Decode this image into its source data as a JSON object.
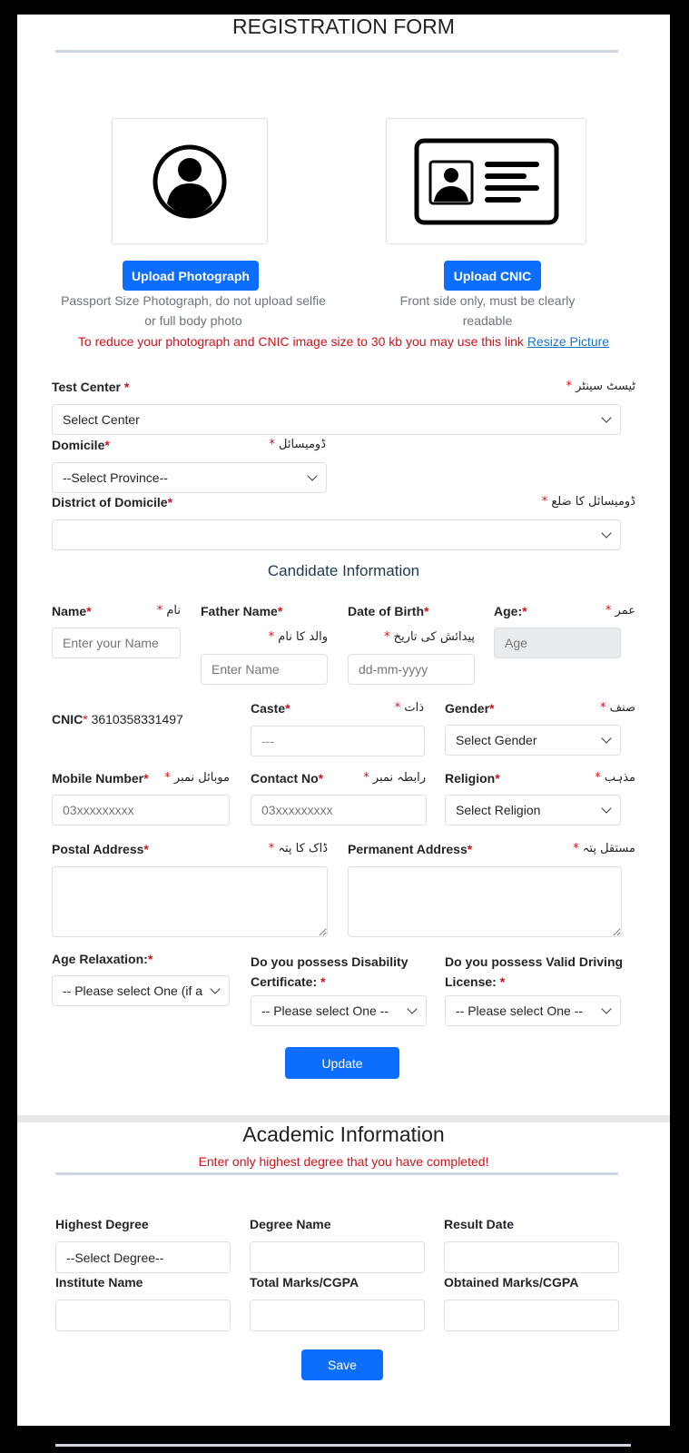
{
  "header": {
    "title": "REGISTRATION FORM"
  },
  "uploads": {
    "photo": {
      "icon": "user-avatar-icon",
      "button": "Upload Photograph",
      "hint_line1": "Passport Size Photograph, do not upload selfie",
      "hint_line2": "or full body photo"
    },
    "cnic": {
      "icon": "id-card-icon",
      "button": "Upload CNIC",
      "hint_line1": "Front side only, must be clearly",
      "hint_line2": "readable"
    },
    "notice": "To reduce your photograph and CNIC image size to 30 kb you may use this link",
    "notice_link": "Resize Picture"
  },
  "location": {
    "test_center": {
      "label": "Test Center",
      "label_ur": "ٹیسٹ سینٹر",
      "value": "Select Center"
    },
    "domicile": {
      "label": "Domicile",
      "label_ur": "ڈومیسائل",
      "value": "--Select Province--"
    },
    "district": {
      "label": "District of Domicile",
      "label_ur": "ڈومیسائل کا ضلع",
      "value": ""
    }
  },
  "candidate": {
    "heading": "Candidate Information",
    "name": {
      "label": "Name",
      "label_ur": "نام",
      "placeholder": "Enter your Name"
    },
    "father_name": {
      "label": "Father Name",
      "label_ur": "والد کا نام",
      "placeholder": "Enter Name"
    },
    "dob": {
      "label": "Date of Birth",
      "label_ur": "پیدائش کی تاریخ",
      "placeholder": "dd-mm-yyyy"
    },
    "age": {
      "label": "Age:",
      "label_ur": "عمر",
      "placeholder": "Age"
    },
    "cnic": {
      "label": "CNIC",
      "value": "3610358331497"
    },
    "caste": {
      "label": "Caste",
      "label_ur": "ذات",
      "value": "---"
    },
    "gender": {
      "label": "Gender",
      "label_ur": "صنف",
      "value": "Select Gender"
    },
    "mobile": {
      "label": "Mobile Number",
      "label_ur": "موبائل نمبر",
      "placeholder": "03xxxxxxxxx"
    },
    "contact": {
      "label": "Contact No",
      "label_ur": "رابطہ نمبر",
      "placeholder": "03xxxxxxxxx"
    },
    "religion": {
      "label": "Religion",
      "label_ur": "مذہب",
      "value": "Select Religion"
    },
    "postal": {
      "label": "Postal Address",
      "label_ur": "ڈاک کا پتہ",
      "value": ""
    },
    "permanent": {
      "label": "Permanent Address",
      "label_ur": "مستقل پتہ",
      "value": ""
    },
    "age_relax": {
      "label": "Age Relaxation:",
      "value": "-- Please select One (if a"
    },
    "disability": {
      "label_line1": "Do you possess Disability",
      "label_line2": "Certificate:",
      "value": "-- Please select One --"
    },
    "driving": {
      "label_line1": "Do you possess Valid Driving",
      "label_line2": "License:",
      "value": "-- Please select One --"
    },
    "update_button": "Update",
    "required_mark": "*"
  },
  "academic": {
    "heading": "Academic Information",
    "notice": "Enter only highest degree that you have completed!",
    "highest_degree": {
      "label": "Highest Degree",
      "value": "--Select Degree--"
    },
    "degree_name": {
      "label": "Degree Name",
      "value": ""
    },
    "result_date": {
      "label": "Result Date",
      "value": ""
    },
    "institute": {
      "label": "Institute Name",
      "value": ""
    },
    "total_marks": {
      "label": "Total Marks/CGPA",
      "value": ""
    },
    "obtained_marks": {
      "label": "Obtained Marks/CGPA",
      "value": ""
    },
    "save_button": "Save"
  }
}
